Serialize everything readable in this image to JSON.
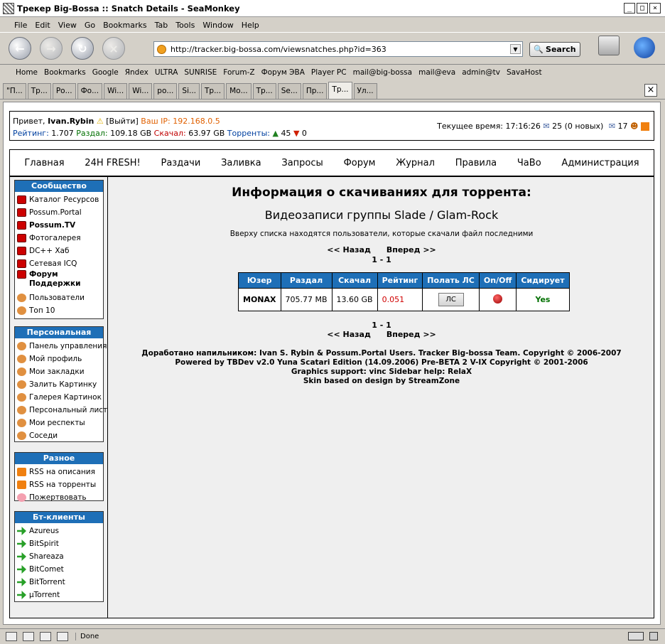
{
  "window": {
    "title": "Трекер Big-Bossa :: Snatch Details - SeaMonkey",
    "min": "_",
    "max": "□",
    "close": "×"
  },
  "menu": [
    "File",
    "Edit",
    "View",
    "Go",
    "Bookmarks",
    "Tab",
    "Tools",
    "Window",
    "Help"
  ],
  "nav": {
    "url": "http://tracker.big-bossa.com/viewsnatches.php?id=363",
    "search_label": "Search"
  },
  "bookmarks": [
    "Home",
    "Bookmarks",
    "Google",
    "Яndex",
    "ULTRA",
    "SUNRISE",
    "Forum-Z",
    "Форум ЭВА",
    "Player PC",
    "mail@big-bossa",
    "mail@eva",
    "admin@tv",
    "SavaHost"
  ],
  "tabs": [
    "\"П...",
    "Тр...",
    "Ро...",
    "Фо...",
    "Wi...",
    "Wi...",
    "ро...",
    "Si...",
    "Тр...",
    "Мо...",
    "Тр...",
    "Se...",
    "Пр...",
    "Тр...",
    "Ул..."
  ],
  "userbar": {
    "greeting": "Привет,",
    "username": "Ivan.Rybin",
    "logout": "[Выйти]",
    "ip_label": "Ваш IP:",
    "ip": "192.168.0.5",
    "rating_label": "Рейтинг:",
    "rating": "1.707",
    "uploaded_label": "Раздал:",
    "uploaded": "109.18 GB",
    "downloaded_label": "Скачал:",
    "downloaded": "63.97 GB",
    "torrents_label": "Торренты:",
    "seeding": "45",
    "leeching": "0",
    "time_label": "Текущее время:",
    "time": "17:16:26",
    "messages": "25 (0 новых)",
    "friends": "17"
  },
  "mainmenu": [
    "Главная",
    "24H FRESH!",
    "Раздачи",
    "Заливка",
    "Запросы",
    "Форум",
    "Журнал",
    "Правила",
    "ЧаВо",
    "Администрация"
  ],
  "sidebar": {
    "community": {
      "title": "Сообщество",
      "items": [
        "Каталог Ресурсов",
        "Possum.Portal",
        "Possum.TV",
        "Фотогалерея",
        "DC++ Хаб",
        "Сетевая ICQ",
        "Форум Поддержки",
        "Пользователи",
        "Топ 10"
      ]
    },
    "personal": {
      "title": "Персональная",
      "items": [
        "Панель управления",
        "Мой профиль",
        "Мои закладки",
        "Залить Картинку",
        "Галерея Картинок",
        "Персональный лист",
        "Мои респекты",
        "Соседи"
      ]
    },
    "misc": {
      "title": "Разное",
      "items": [
        "RSS на описания",
        "RSS на торренты",
        "Пожертвовать"
      ]
    },
    "clients": {
      "title": "Бт-клиенты",
      "items": [
        "Azureus",
        "BitSpirit",
        "Shareaza",
        "BitComet",
        "BitTorrent",
        "µTorrent"
      ]
    }
  },
  "page": {
    "title": "Информация о скачиваниях для торрента:",
    "torrent": "Видеозаписи группы Slade / Glam-Rock",
    "note": "Вверху списка находятся пользователи, которые скачали файл последними",
    "prev": "<< Назад",
    "next": "Вперед >>",
    "range": "1 - 1"
  },
  "table": {
    "headers": [
      "Юзер",
      "Раздал",
      "Скачал",
      "Рейтинг",
      "Полать ЛС",
      "On/Off",
      "Сидирует"
    ],
    "rows": [
      {
        "user": "MONAX",
        "up": "705.77 MB",
        "down": "13.60 GB",
        "ratio": "0.051",
        "pm": "ЛС",
        "seeding": "Yes"
      }
    ]
  },
  "footer": [
    "Доработано напильником: Ivan S. Rybin & Possum.Portal Users. Tracker Big-bossa Team. Copyright © 2006-2007",
    "Powered by TBDev v2.0 Yuna Scatari Edition (14.09.2006) Pre-BETA 2 V-IX Copyright © 2001-2006",
    "Graphics support: vinc Sidebar help: RelaX",
    "Skin based on design by StreamZone"
  ],
  "status": "Done"
}
